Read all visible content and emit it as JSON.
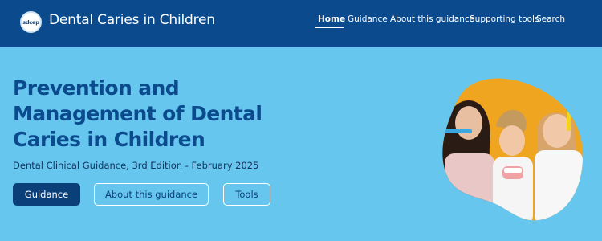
{
  "header": {
    "logo_text": "sdcep",
    "title": "Dental Caries in Children",
    "nav": [
      {
        "label": "Home",
        "active": true
      },
      {
        "label": "Guidance",
        "active": false
      },
      {
        "label": "About this guidance",
        "active": false
      },
      {
        "label": "Supporting tools",
        "active": false
      },
      {
        "label": "Search",
        "active": false
      }
    ]
  },
  "hero": {
    "title": "Prevention and Management of Dental Caries in Children",
    "subtitle": "Dental Clinical Guidance, 3rd Edition - February 2025",
    "buttons": [
      {
        "label": "Guidance"
      },
      {
        "label": "About this guidance"
      },
      {
        "label": "Tools"
      }
    ]
  },
  "colors": {
    "header_bg": "#0b4a8c",
    "page_bg": "#66c6ee",
    "primary_button": "#0b3f7a",
    "title_text": "#0b4a8c",
    "photo_bg": "#f0a521"
  }
}
